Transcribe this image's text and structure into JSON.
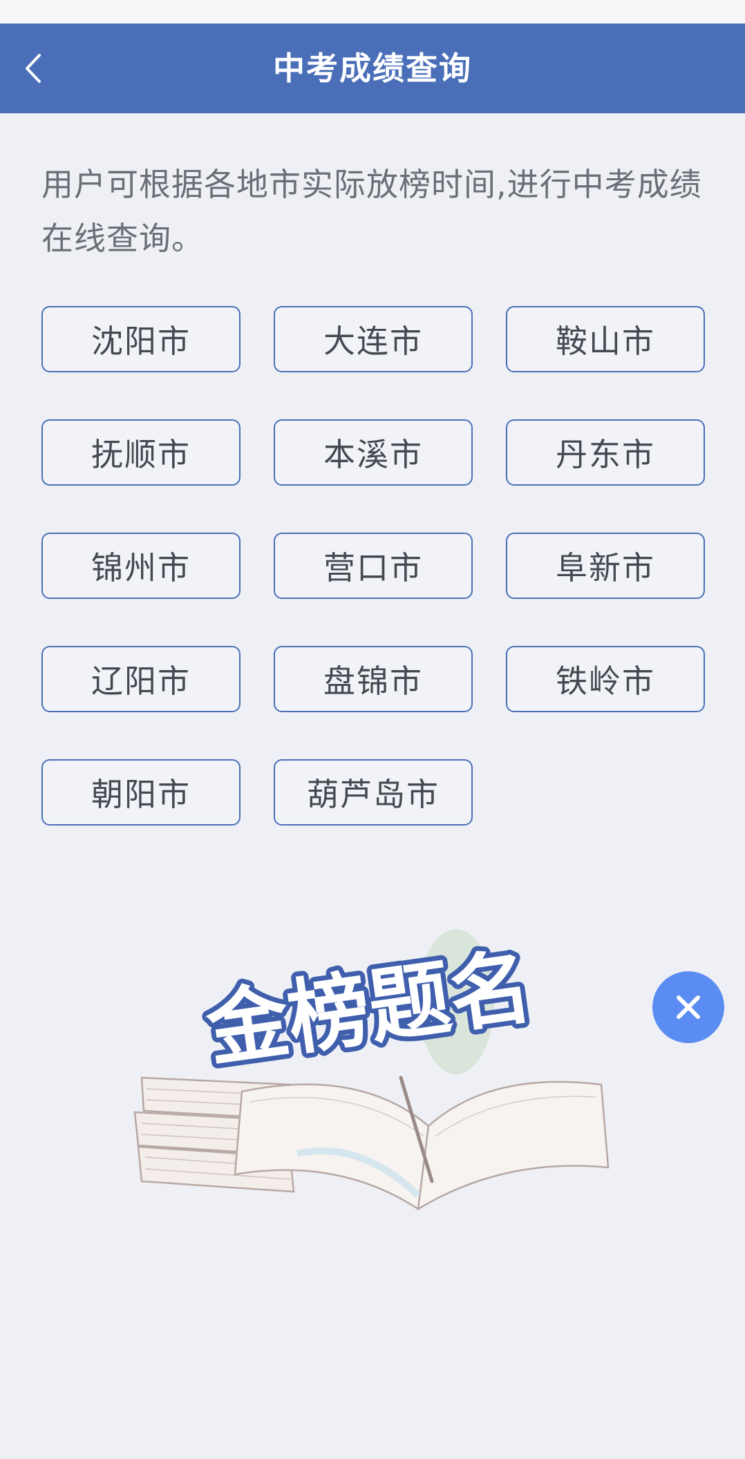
{
  "header": {
    "title": "中考成绩查询",
    "back_icon": "chevron-left-icon"
  },
  "intro": {
    "text": "用户可根据各地市实际放榜时间,进行中考成绩在线查询。"
  },
  "cities": [
    "沈阳市",
    "大连市",
    "鞍山市",
    "抚顺市",
    "本溪市",
    "丹东市",
    "锦州市",
    "营口市",
    "阜新市",
    "辽阳市",
    "盘锦市",
    "铁岭市",
    "朝阳市",
    "葫芦岛市"
  ],
  "banner": {
    "title": "金榜题名",
    "icon": "open-books-illustration"
  },
  "close_button": {
    "icon": "close-icon"
  },
  "colors": {
    "accent": "#4a6fb8",
    "background": "#eef0f5",
    "close_button": "#5a8cf2",
    "button_text": "#45484f",
    "intro_text": "#6b6e75"
  }
}
